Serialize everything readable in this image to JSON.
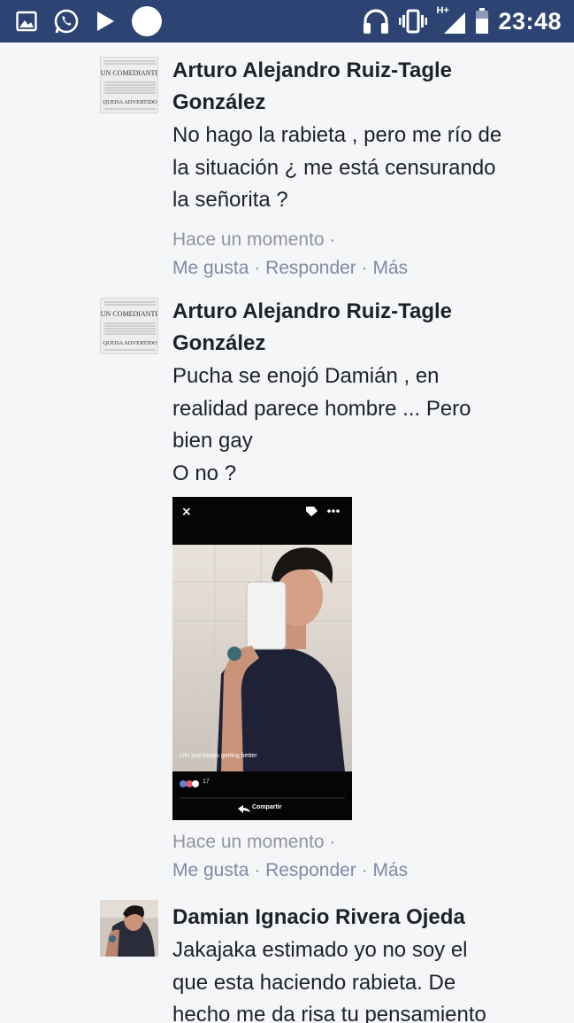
{
  "status_bar": {
    "time": "23:48",
    "network": "H+",
    "left_icons": [
      "gallery-icon",
      "whatsapp-icon",
      "play-icon",
      "circle-icon"
    ],
    "right_icons": [
      "headphones-icon",
      "vibrate-icon",
      "signal-icon",
      "battery-icon"
    ]
  },
  "comments": [
    {
      "author_line1": "Arturo Alejandro Ruiz-Tagle",
      "author_line2": "González",
      "text_lines": [
        "No hago la rabieta , pero me río de",
        "la situación ¿ me está censurando",
        "la señorita ?"
      ],
      "timestamp": "Hace un momento",
      "actions": {
        "like": "Me gusta",
        "reply": "Responder",
        "more": "Más"
      },
      "avatar_text": [
        "UN COMEDIANTE",
        "QUEDA ADVERTIDO"
      ]
    },
    {
      "author_line1": "Arturo Alejandro Ruiz-Tagle",
      "author_line2": "González",
      "text_lines": [
        "Pucha se enojó Damián , en",
        "realidad parece hombre ... Pero",
        "bien gay",
        "O no ?"
      ],
      "timestamp": "Hace un momento",
      "actions": {
        "like": "Me gusta",
        "reply": "Responder",
        "more": "Más"
      },
      "avatar_text": [
        "UN COMEDIANTE",
        "QUEDA ADVERTIDO"
      ],
      "photo": {
        "caption": "Life just keeps getting better",
        "reaction_count": "17",
        "share_label": "Compartir"
      }
    },
    {
      "author_line1": "Damian Ignacio Rivera Ojeda",
      "text_lines": [
        "Jakajaka estimado yo no soy el",
        "que esta haciendo rabieta. De",
        "hecho me da risa tu pensamiento"
      ]
    }
  ]
}
